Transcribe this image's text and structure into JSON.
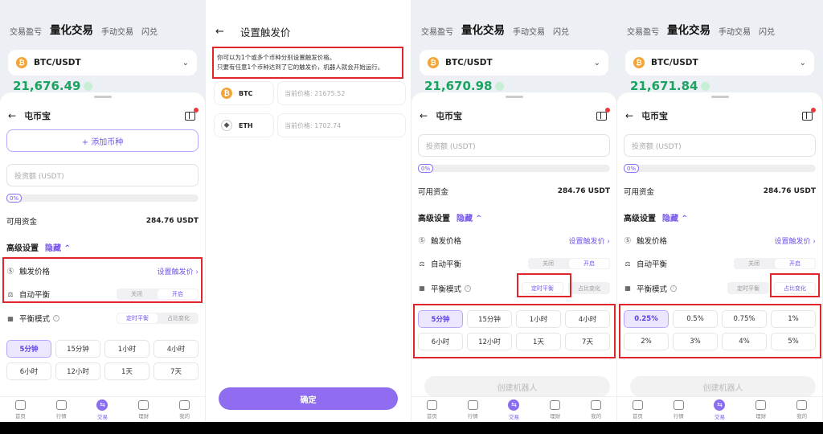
{
  "common": {
    "nav": {
      "tab1": "交易盈亏",
      "tab2": "量化交易",
      "tab3": "手动交易",
      "tab4": "闪兑"
    },
    "pair": "BTC/USDT",
    "sheet_title": "屯币宝",
    "invest_placeholder": "投资额 (USDT)",
    "progress_pct": "0%",
    "available_label": "可用资金",
    "available_value": "284.76 USDT",
    "advanced_label": "高级设置",
    "hide_label": "隐藏",
    "trigger_label": "触发价格",
    "trigger_link": "设置触发价",
    "auto_balance_label": "自动平衡",
    "off_label": "关闭",
    "on_label": "开启",
    "mode_label": "平衡模式",
    "mode_timed": "定时平衡",
    "mode_ratio": "占比变化",
    "create_label": "创建机器人",
    "add_coin": "+ 添加币种",
    "tabbar": [
      "首页",
      "行情",
      "交易",
      "理财",
      "我的"
    ]
  },
  "panel1": {
    "price": "21,676.49",
    "time_options": [
      "5分钟",
      "15分钟",
      "1小时",
      "4小时",
      "6小时",
      "12小时",
      "1天",
      "7天"
    ]
  },
  "panel2": {
    "title": "设置触发价",
    "note_line1": "你可以为1个或多个币种分别设置触发价格。",
    "note_line2": "只要有任意1个币种达到了它的触发价，机器人就会开始运行。",
    "coins": [
      {
        "name": "BTC",
        "price": "当前价格: 21675.52"
      },
      {
        "name": "ETH",
        "price": "当前价格: 1702.74"
      }
    ],
    "confirm": "确定"
  },
  "panel3": {
    "price": "21,670.98",
    "time_options": [
      "5分钟",
      "15分钟",
      "1小时",
      "4小时",
      "6小时",
      "12小时",
      "1天",
      "7天"
    ]
  },
  "panel4": {
    "price": "21,671.84",
    "ratio_options": [
      "0.25%",
      "0.5%",
      "0.75%",
      "1%",
      "2%",
      "3%",
      "4%",
      "5%"
    ]
  },
  "colors": {
    "accent": "#7656e8",
    "up": "#1ca362",
    "highlight": "#e0262b"
  }
}
